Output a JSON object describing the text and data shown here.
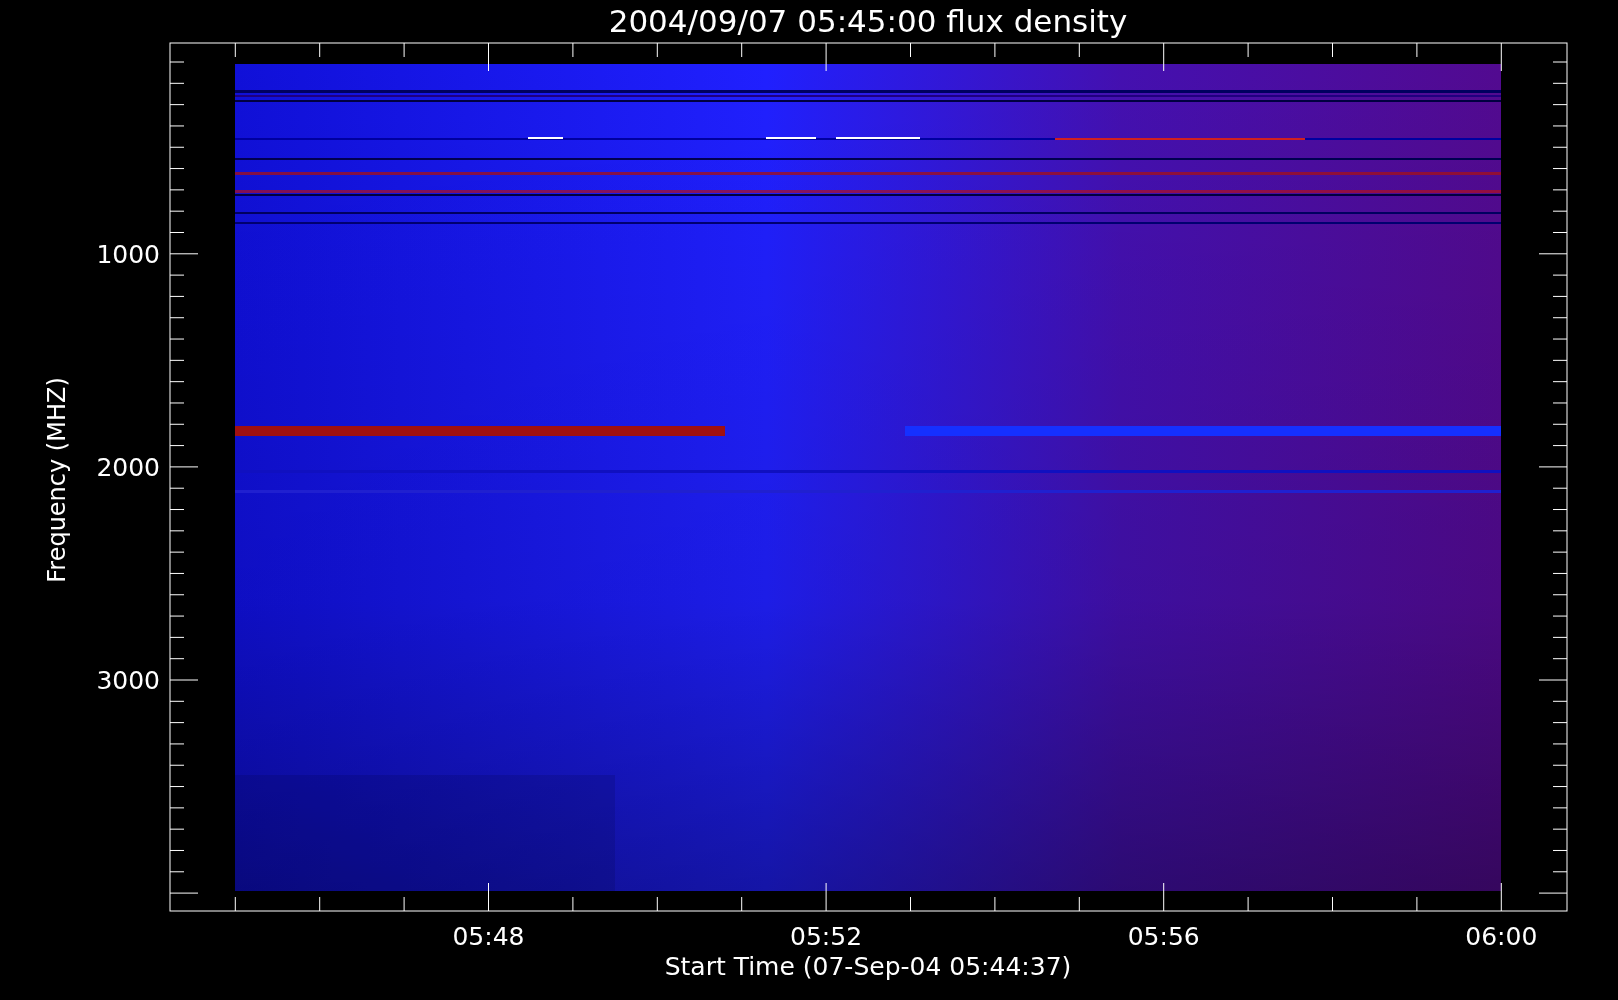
{
  "title": "2004/09/07 05:45:00 flux density",
  "y_axis": {
    "label": "Frequency (MHZ)",
    "ticks": [
      {
        "label": "1000"
      },
      {
        "label": "2000"
      },
      {
        "label": "3000"
      }
    ]
  },
  "x_axis": {
    "label": "Start Time (07-Sep-04 05:44:37)",
    "ticks": [
      {
        "label": "05:48"
      },
      {
        "label": "05:52"
      },
      {
        "label": "05:56"
      },
      {
        "label": "06:00"
      }
    ]
  }
}
